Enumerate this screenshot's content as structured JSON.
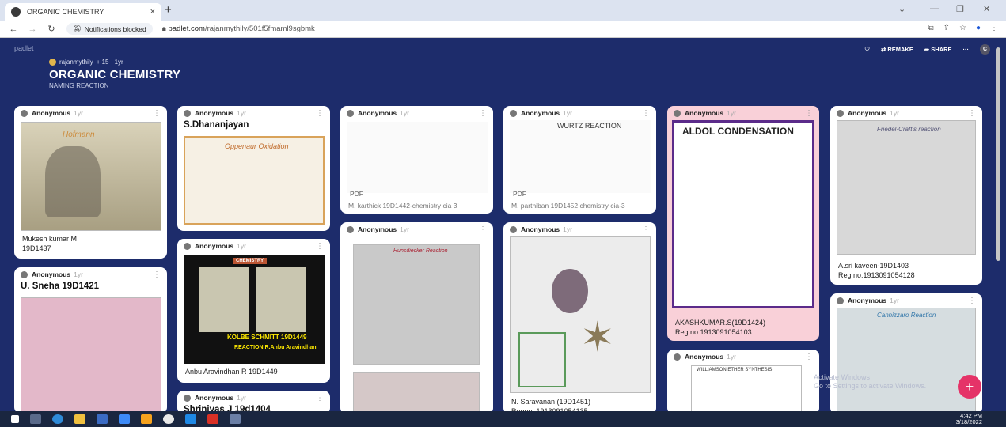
{
  "browser": {
    "tab_title": "ORGANIC CHEMISTRY",
    "tab_close": "×",
    "new_tab": "+",
    "notifications": "Notifications blocked",
    "url_host": "padlet.com",
    "url_path": "/rajanmythily/501f5fmaml9sgbmk"
  },
  "padlet": {
    "logo": "padlet",
    "user": "rajanmythily",
    "user_meta": "+ 15 · 1yr",
    "title": "ORGANIC CHEMISTRY",
    "subtitle": "NAMING REACTION",
    "remake": "REMAKE",
    "share": "SHARE",
    "more": "···",
    "avatar_letter": "C"
  },
  "cards": [
    {
      "author": "Anonymous",
      "time": "1yr",
      "img_label": "Hofmann",
      "caption": "Mukesh kumar M\n19D1437"
    },
    {
      "author": "Anonymous",
      "time": "1yr",
      "title": "U. Sneha 19D1421"
    },
    {
      "author": "Anonymous",
      "time": "1yr",
      "title": "S.Dhananjayan",
      "img_label": "Oppenaur Oxidation"
    },
    {
      "author": "Anonymous",
      "time": "1yr",
      "img_label_1": "CHEMISTRY",
      "img_label_2": "KOLBE SCHMITT 19D1449",
      "img_label_3": "REACTION R.Anbu Aravindhan",
      "caption": "Anbu Aravindhan R 19D1449"
    },
    {
      "author": "Anonymous",
      "time": "1yr",
      "title": "Shrinivas J 19d1404"
    },
    {
      "author": "Anonymous",
      "time": "1yr",
      "pdf": "PDF",
      "caption": "M. karthick 19D1442-chemistry cia 3"
    },
    {
      "author": "Anonymous",
      "time": "1yr",
      "img_label": "Hunsdiecker Reaction"
    },
    {
      "author": "Anonymous",
      "time": "1yr",
      "img_label": "WURTZ REACTION",
      "pdf": "PDF",
      "caption": "M. parthiban 19D1452 chemistry cia-3"
    },
    {
      "author": "Anonymous",
      "time": "1yr",
      "caption": "N. Saravanan (19D1451)\nRegno: 1913091054135"
    },
    {
      "author": "Anonymous",
      "time": "1yr",
      "img_label": "ALDOL CONDENSATION",
      "caption": "AKASHKUMAR.S(19D1424)\nReg no:1913091054103"
    },
    {
      "author": "Anonymous",
      "time": "1yr",
      "img_label": "WILLIAMSON ETHER SYNTHESIS"
    },
    {
      "author": "Anonymous",
      "time": "1yr",
      "img_label": "Friedel-Craft's reaction",
      "caption": "A.sri kaveen-19D1403\nReg no:1913091054128"
    },
    {
      "author": "Anonymous",
      "time": "1yr",
      "img_label": "Cannizzaro Reaction"
    }
  ],
  "fab": "+",
  "watermark": "Activate Windows\nGo to Settings to activate Windows.",
  "taskbar": {
    "time": "4:42 PM",
    "date": "3/18/2022"
  },
  "colors": {
    "bg": "#1d2c6b",
    "fab": "#e53368",
    "pink_card": "#f9d0d8"
  }
}
